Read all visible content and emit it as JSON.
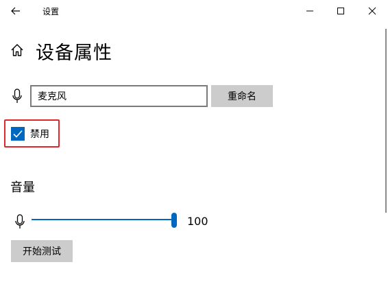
{
  "window": {
    "title": "设置",
    "back_icon": "arrow-left-icon",
    "controls": [
      "minimize-icon",
      "maximize-icon",
      "close-icon"
    ]
  },
  "page": {
    "home_icon": "home-icon",
    "title": "设备属性"
  },
  "device": {
    "icon": "microphone-icon",
    "name_value": "麦克风",
    "rename_label": "重命名"
  },
  "disable": {
    "label": "禁用",
    "checked": true,
    "highlight_color": "#e0262a"
  },
  "volume": {
    "title": "音量",
    "icon": "microphone-icon",
    "value": 100,
    "value_text": "100",
    "level_fraction": 1.0
  },
  "test": {
    "label": "开始测试"
  },
  "colors": {
    "accent": "#0067c0",
    "button_bg": "#cccccc"
  }
}
